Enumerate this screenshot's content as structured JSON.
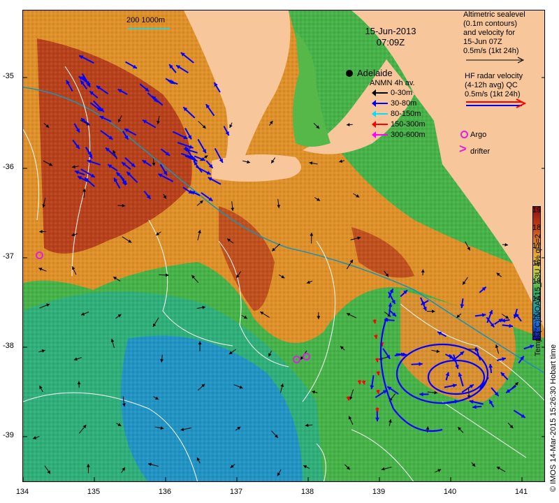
{
  "map": {
    "date": "15-Jun-2013",
    "time": "07:09Z",
    "city": "Adelaide",
    "contour_label": "200  1000m",
    "altimetric_note": [
      "Altimetric sealevel",
      "(0.1m contours)",
      "and velocity for",
      "15-Jun 07Z",
      "0.5m/s (1kt 24h)"
    ],
    "hf_note": [
      "HF radar velocity",
      "(4-12h avg) ",
      "0.5m/s (1kt 24h)"
    ],
    "hf_qc": "QC",
    "anmn_title": "ANMN 4h av.",
    "anmn_legend": [
      {
        "label": "0-30m",
        "color": "#000000"
      },
      {
        "label": "30-80m",
        "color": "#0000ff"
      },
      {
        "label": "80-150m",
        "color": "#00e0ff"
      },
      {
        "label": "150-300m",
        "color": "#ff0000"
      },
      {
        "label": "300-600m",
        "color": "#ff00ff"
      }
    ],
    "argo_label": "Argo",
    "drifter_label": "drifter",
    "drifter_symbol": ">",
    "colorbar_title": "Temp. (°C) NOAA15_L3U 4% ql>=2",
    "colorbar_ticks": [
      "19",
      "18",
      "17",
      "16",
      "15",
      "14",
      "13",
      "12"
    ],
    "credit": "© IMOS 14-Mar-2015 15:26:30 Hobart time",
    "lat_ticks": [
      "-35",
      "-36",
      "-37",
      "-38",
      "-39"
    ],
    "lon_ticks": [
      "134",
      "135",
      "136",
      "137",
      "138",
      "139",
      "140",
      "141"
    ],
    "colors": {
      "land": "#f7c79b",
      "warm": "#b03010",
      "mid": "#e8a020",
      "cool": "#2aa048",
      "cold": "#1e6fd0",
      "current_line": "#2090b0",
      "contour": "#ffffff"
    }
  }
}
